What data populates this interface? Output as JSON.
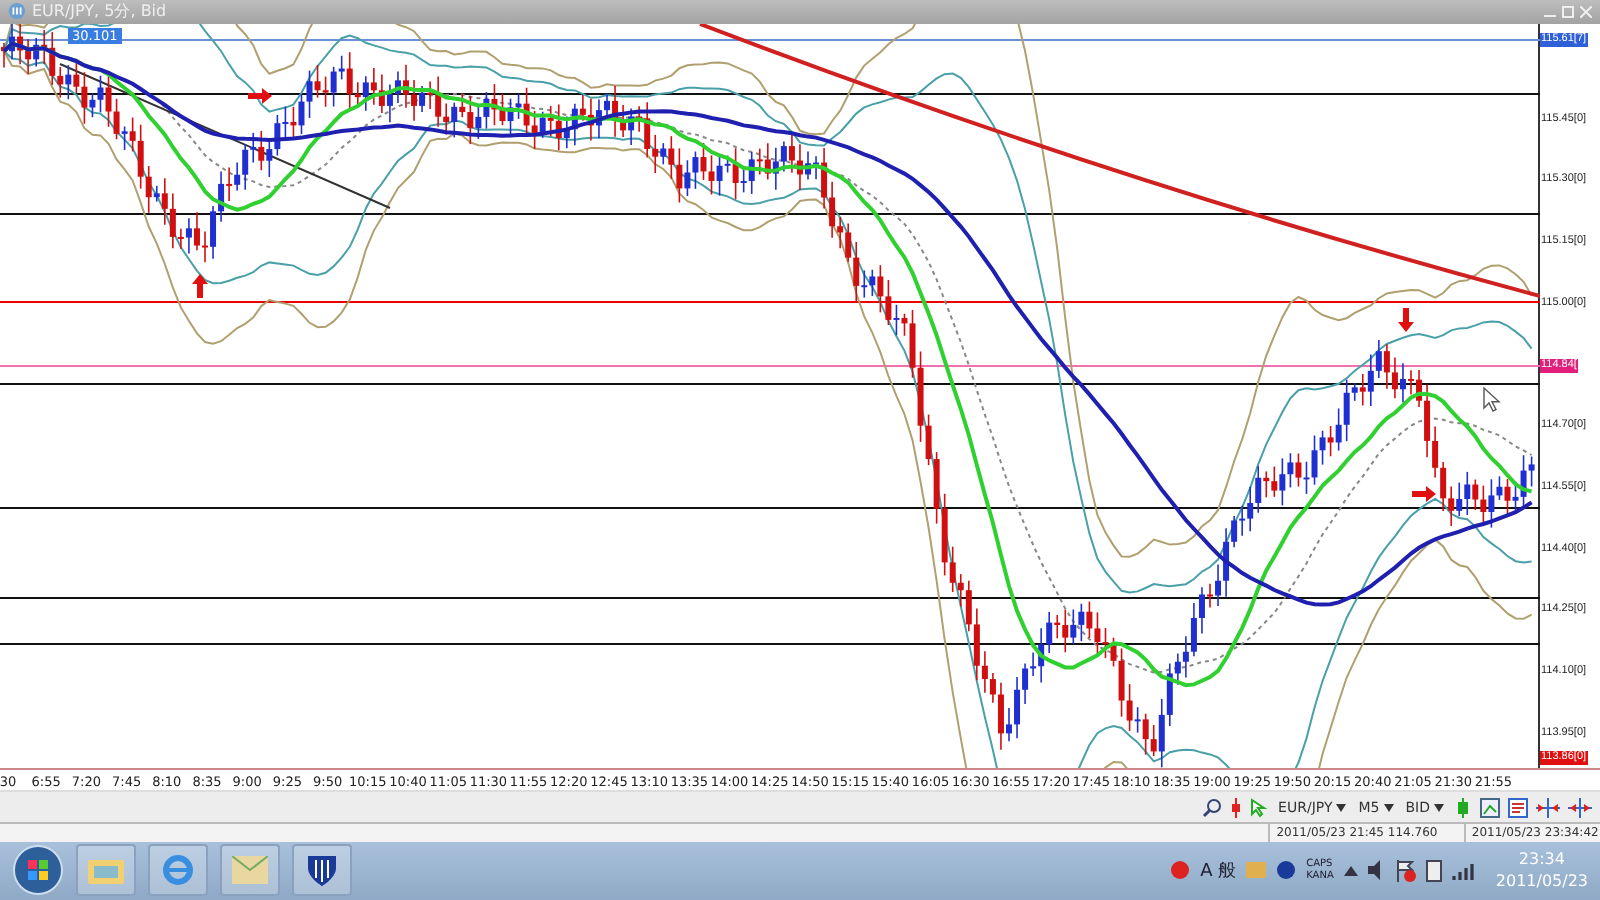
{
  "window": {
    "title": "EUR/JPY, 5分, Bid"
  },
  "chart": {
    "cursor_readout": "30.101",
    "price_labels": [
      {
        "text": "115.61[7]",
        "kind": "tag",
        "color": "#3060d8"
      },
      {
        "text": "115.45[0]",
        "kind": "plain"
      },
      {
        "text": "115.30[0]",
        "kind": "plain"
      },
      {
        "text": "115.15[0]",
        "kind": "plain"
      },
      {
        "text": "115.00[0]",
        "kind": "plain"
      },
      {
        "text": "114.84[",
        "kind": "tag",
        "color": "#e0207a"
      },
      {
        "text": "114.70[0]",
        "kind": "plain"
      },
      {
        "text": "114.55[0]",
        "kind": "plain"
      },
      {
        "text": "114.40[0]",
        "kind": "plain"
      },
      {
        "text": "114.25[0]",
        "kind": "plain"
      },
      {
        "text": "114.10[0]",
        "kind": "plain"
      },
      {
        "text": "113.95[0]",
        "kind": "plain"
      },
      {
        "text": "113.86[0]",
        "kind": "tag",
        "color": "#e01010"
      }
    ],
    "time_labels": [
      "30",
      "6:55",
      "7:20",
      "7:45",
      "8:10",
      "8:35",
      "9:00",
      "9:25",
      "9:50",
      "10:15",
      "10:40",
      "11:05",
      "11:30",
      "11:55",
      "12:20",
      "12:45",
      "13:10",
      "13:35",
      "14:00",
      "14:25",
      "14:50",
      "15:15",
      "15:40",
      "16:05",
      "16:30",
      "16:55",
      "17:20",
      "17:45",
      "18:10",
      "18:35",
      "19:00",
      "19:25",
      "19:50",
      "20:15",
      "20:40",
      "21:05",
      "21:30",
      "21:55"
    ]
  },
  "toolbar": {
    "symbol": "EUR/JPY",
    "timeframe": "M5",
    "price_type": "BID"
  },
  "status_bar": {
    "bar_info": "2011/05/23 21:45  114.760",
    "server_time": "2011/05/23 23:34:42"
  },
  "taskbar": {
    "ime": "A 般",
    "caps": "CAPS",
    "kana": "KANA",
    "time": "23:34",
    "date": "2011/05/23"
  }
}
